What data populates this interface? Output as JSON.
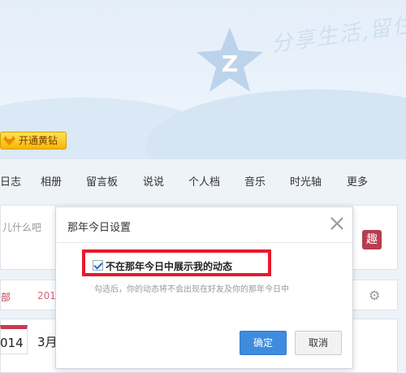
{
  "header": {
    "slogan": "分享生活,留住",
    "vip_button": "开通黄钻"
  },
  "nav": {
    "items": [
      "日志",
      "相册",
      "留言板",
      "说说",
      "个人档",
      "音乐",
      "时光轴",
      "更多"
    ]
  },
  "post": {
    "placeholder": "儿什么吧",
    "fun_icon_label": "趣"
  },
  "feed": {
    "tab_all": "部",
    "tab_year": "201"
  },
  "timeline": {
    "year": "014",
    "month": "3月"
  },
  "dialog": {
    "title": "那年今日设置",
    "checkbox_label": "不在那年今日中展示我的动态",
    "checkbox_checked": true,
    "hint": "勾选后，你的动态将不会出现在好友及你的那年今日中",
    "ok_label": "确定",
    "cancel_label": "取消"
  },
  "colors": {
    "accent_blue": "#3f8cdf",
    "highlight_red": "#e8192c",
    "brand_red": "#c83b52"
  }
}
